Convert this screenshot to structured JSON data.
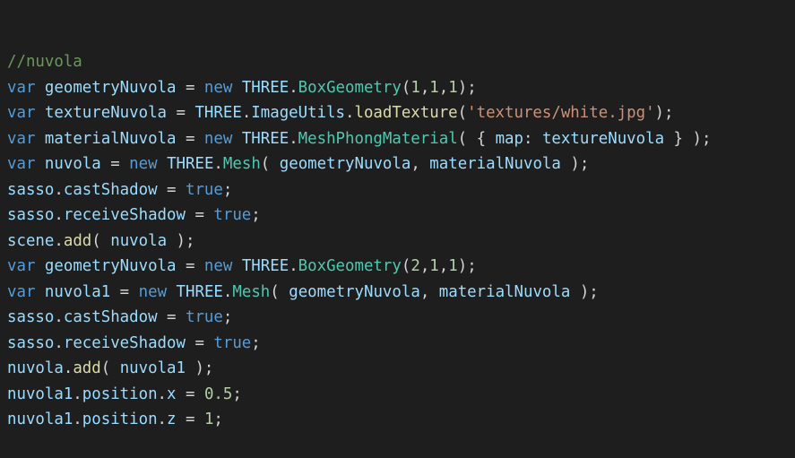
{
  "theme": {
    "background": "#1e1e1e",
    "comment": "#6a9955",
    "keyword": "#569cd6",
    "variable": "#9cdcfe",
    "plain": "#d4d4d4",
    "class": "#4ec9b0",
    "function": "#dcdcaa",
    "number": "#b5cea8",
    "string": "#ce9178"
  },
  "code": {
    "lines": [
      [
        {
          "t": "comment",
          "v": "//nuvola"
        }
      ],
      [
        {
          "t": "keyword",
          "v": "var"
        },
        {
          "t": "plain",
          "v": " "
        },
        {
          "t": "var",
          "v": "geometryNuvola"
        },
        {
          "t": "plain",
          "v": " = "
        },
        {
          "t": "keyword",
          "v": "new"
        },
        {
          "t": "plain",
          "v": " "
        },
        {
          "t": "var",
          "v": "THREE"
        },
        {
          "t": "plain",
          "v": "."
        },
        {
          "t": "class",
          "v": "BoxGeometry"
        },
        {
          "t": "plain",
          "v": "("
        },
        {
          "t": "number",
          "v": "1"
        },
        {
          "t": "plain",
          "v": ","
        },
        {
          "t": "number",
          "v": "1"
        },
        {
          "t": "plain",
          "v": ","
        },
        {
          "t": "number",
          "v": "1"
        },
        {
          "t": "plain",
          "v": ");"
        }
      ],
      [
        {
          "t": "keyword",
          "v": "var"
        },
        {
          "t": "plain",
          "v": " "
        },
        {
          "t": "var",
          "v": "textureNuvola"
        },
        {
          "t": "plain",
          "v": " = "
        },
        {
          "t": "var",
          "v": "THREE"
        },
        {
          "t": "plain",
          "v": "."
        },
        {
          "t": "var",
          "v": "ImageUtils"
        },
        {
          "t": "plain",
          "v": "."
        },
        {
          "t": "func",
          "v": "loadTexture"
        },
        {
          "t": "plain",
          "v": "("
        },
        {
          "t": "string",
          "v": "'textures/white.jpg'"
        },
        {
          "t": "plain",
          "v": ");"
        }
      ],
      [
        {
          "t": "keyword",
          "v": "var"
        },
        {
          "t": "plain",
          "v": " "
        },
        {
          "t": "var",
          "v": "materialNuvola"
        },
        {
          "t": "plain",
          "v": " = "
        },
        {
          "t": "keyword",
          "v": "new"
        },
        {
          "t": "plain",
          "v": " "
        },
        {
          "t": "var",
          "v": "THREE"
        },
        {
          "t": "plain",
          "v": "."
        },
        {
          "t": "class",
          "v": "MeshPhongMaterial"
        },
        {
          "t": "plain",
          "v": "( { "
        },
        {
          "t": "var",
          "v": "map"
        },
        {
          "t": "plain",
          "v": ": "
        },
        {
          "t": "var",
          "v": "textureNuvola"
        },
        {
          "t": "plain",
          "v": " } );"
        }
      ],
      [
        {
          "t": "keyword",
          "v": "var"
        },
        {
          "t": "plain",
          "v": " "
        },
        {
          "t": "var",
          "v": "nuvola"
        },
        {
          "t": "plain",
          "v": " = "
        },
        {
          "t": "keyword",
          "v": "new"
        },
        {
          "t": "plain",
          "v": " "
        },
        {
          "t": "var",
          "v": "THREE"
        },
        {
          "t": "plain",
          "v": "."
        },
        {
          "t": "class",
          "v": "Mesh"
        },
        {
          "t": "plain",
          "v": "( "
        },
        {
          "t": "var",
          "v": "geometryNuvola"
        },
        {
          "t": "plain",
          "v": ", "
        },
        {
          "t": "var",
          "v": "materialNuvola"
        },
        {
          "t": "plain",
          "v": " );"
        }
      ],
      [
        {
          "t": "var",
          "v": "sasso"
        },
        {
          "t": "plain",
          "v": "."
        },
        {
          "t": "var",
          "v": "castShadow"
        },
        {
          "t": "plain",
          "v": " = "
        },
        {
          "t": "bool",
          "v": "true"
        },
        {
          "t": "plain",
          "v": ";"
        }
      ],
      [
        {
          "t": "var",
          "v": "sasso"
        },
        {
          "t": "plain",
          "v": "."
        },
        {
          "t": "var",
          "v": "receiveShadow"
        },
        {
          "t": "plain",
          "v": " = "
        },
        {
          "t": "bool",
          "v": "true"
        },
        {
          "t": "plain",
          "v": ";"
        }
      ],
      [
        {
          "t": "var",
          "v": "scene"
        },
        {
          "t": "plain",
          "v": "."
        },
        {
          "t": "func",
          "v": "add"
        },
        {
          "t": "plain",
          "v": "( "
        },
        {
          "t": "var",
          "v": "nuvola"
        },
        {
          "t": "plain",
          "v": " );"
        }
      ],
      [
        {
          "t": "keyword",
          "v": "var"
        },
        {
          "t": "plain",
          "v": " "
        },
        {
          "t": "var",
          "v": "geometryNuvola"
        },
        {
          "t": "plain",
          "v": " = "
        },
        {
          "t": "keyword",
          "v": "new"
        },
        {
          "t": "plain",
          "v": " "
        },
        {
          "t": "var",
          "v": "THREE"
        },
        {
          "t": "plain",
          "v": "."
        },
        {
          "t": "class",
          "v": "BoxGeometry"
        },
        {
          "t": "plain",
          "v": "("
        },
        {
          "t": "number",
          "v": "2"
        },
        {
          "t": "plain",
          "v": ","
        },
        {
          "t": "number",
          "v": "1"
        },
        {
          "t": "plain",
          "v": ","
        },
        {
          "t": "number",
          "v": "1"
        },
        {
          "t": "plain",
          "v": ");"
        }
      ],
      [
        {
          "t": "keyword",
          "v": "var"
        },
        {
          "t": "plain",
          "v": " "
        },
        {
          "t": "var",
          "v": "nuvola1"
        },
        {
          "t": "plain",
          "v": " = "
        },
        {
          "t": "keyword",
          "v": "new"
        },
        {
          "t": "plain",
          "v": " "
        },
        {
          "t": "var",
          "v": "THREE"
        },
        {
          "t": "plain",
          "v": "."
        },
        {
          "t": "class",
          "v": "Mesh"
        },
        {
          "t": "plain",
          "v": "( "
        },
        {
          "t": "var",
          "v": "geometryNuvola"
        },
        {
          "t": "plain",
          "v": ", "
        },
        {
          "t": "var",
          "v": "materialNuvola"
        },
        {
          "t": "plain",
          "v": " );"
        }
      ],
      [
        {
          "t": "var",
          "v": "sasso"
        },
        {
          "t": "plain",
          "v": "."
        },
        {
          "t": "var",
          "v": "castShadow"
        },
        {
          "t": "plain",
          "v": " = "
        },
        {
          "t": "bool",
          "v": "true"
        },
        {
          "t": "plain",
          "v": ";"
        }
      ],
      [
        {
          "t": "var",
          "v": "sasso"
        },
        {
          "t": "plain",
          "v": "."
        },
        {
          "t": "var",
          "v": "receiveShadow"
        },
        {
          "t": "plain",
          "v": " = "
        },
        {
          "t": "bool",
          "v": "true"
        },
        {
          "t": "plain",
          "v": ";"
        }
      ],
      [
        {
          "t": "var",
          "v": "nuvola"
        },
        {
          "t": "plain",
          "v": "."
        },
        {
          "t": "func",
          "v": "add"
        },
        {
          "t": "plain",
          "v": "( "
        },
        {
          "t": "var",
          "v": "nuvola1"
        },
        {
          "t": "plain",
          "v": " );"
        }
      ],
      [
        {
          "t": "var",
          "v": "nuvola1"
        },
        {
          "t": "plain",
          "v": "."
        },
        {
          "t": "var",
          "v": "position"
        },
        {
          "t": "plain",
          "v": "."
        },
        {
          "t": "var",
          "v": "x"
        },
        {
          "t": "plain",
          "v": " = "
        },
        {
          "t": "number",
          "v": "0.5"
        },
        {
          "t": "plain",
          "v": ";"
        }
      ],
      [
        {
          "t": "var",
          "v": "nuvola1"
        },
        {
          "t": "plain",
          "v": "."
        },
        {
          "t": "var",
          "v": "position"
        },
        {
          "t": "plain",
          "v": "."
        },
        {
          "t": "var",
          "v": "z"
        },
        {
          "t": "plain",
          "v": " = "
        },
        {
          "t": "number",
          "v": "1"
        },
        {
          "t": "plain",
          "v": ";"
        }
      ]
    ]
  }
}
